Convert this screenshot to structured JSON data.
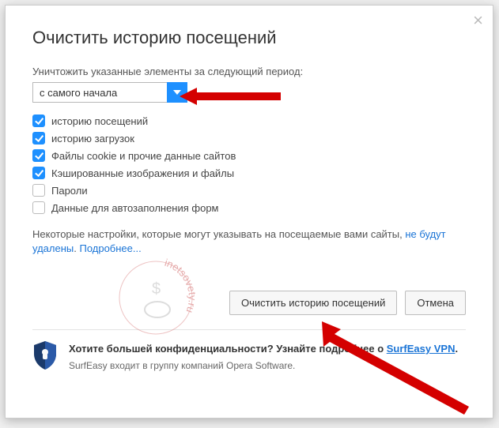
{
  "dialog": {
    "title": "Очистить историю посещений",
    "period_label": "Уничтожить указанные элементы за следующий период:",
    "period_value": "с самого начала",
    "options": [
      {
        "label": "историю посещений",
        "checked": true
      },
      {
        "label": "историю загрузок",
        "checked": true
      },
      {
        "label": "Файлы cookie и прочие данные сайтов",
        "checked": true
      },
      {
        "label": "Кэшированные изображения и файлы",
        "checked": true
      },
      {
        "label": "Пароли",
        "checked": false
      },
      {
        "label": "Данные для автозаполнения форм",
        "checked": false
      }
    ],
    "info_prefix": "Некоторые настройки, которые могут указывать на посещаемые вами сайты, ",
    "info_link1": "не будут удалены",
    "info_sep": ". ",
    "info_link2": "Подробнее...",
    "clear_button": "Очистить историю посещений",
    "cancel_button": "Отмена"
  },
  "footer": {
    "title_prefix": "Хотите большей конфиденциальности? Узнайте подробнее о ",
    "link": "SurfEasy VPN",
    "suffix": ".",
    "subtext": "SurfEasy входит в группу компаний Opera Software."
  },
  "watermark_text": "inetsovety.ru"
}
